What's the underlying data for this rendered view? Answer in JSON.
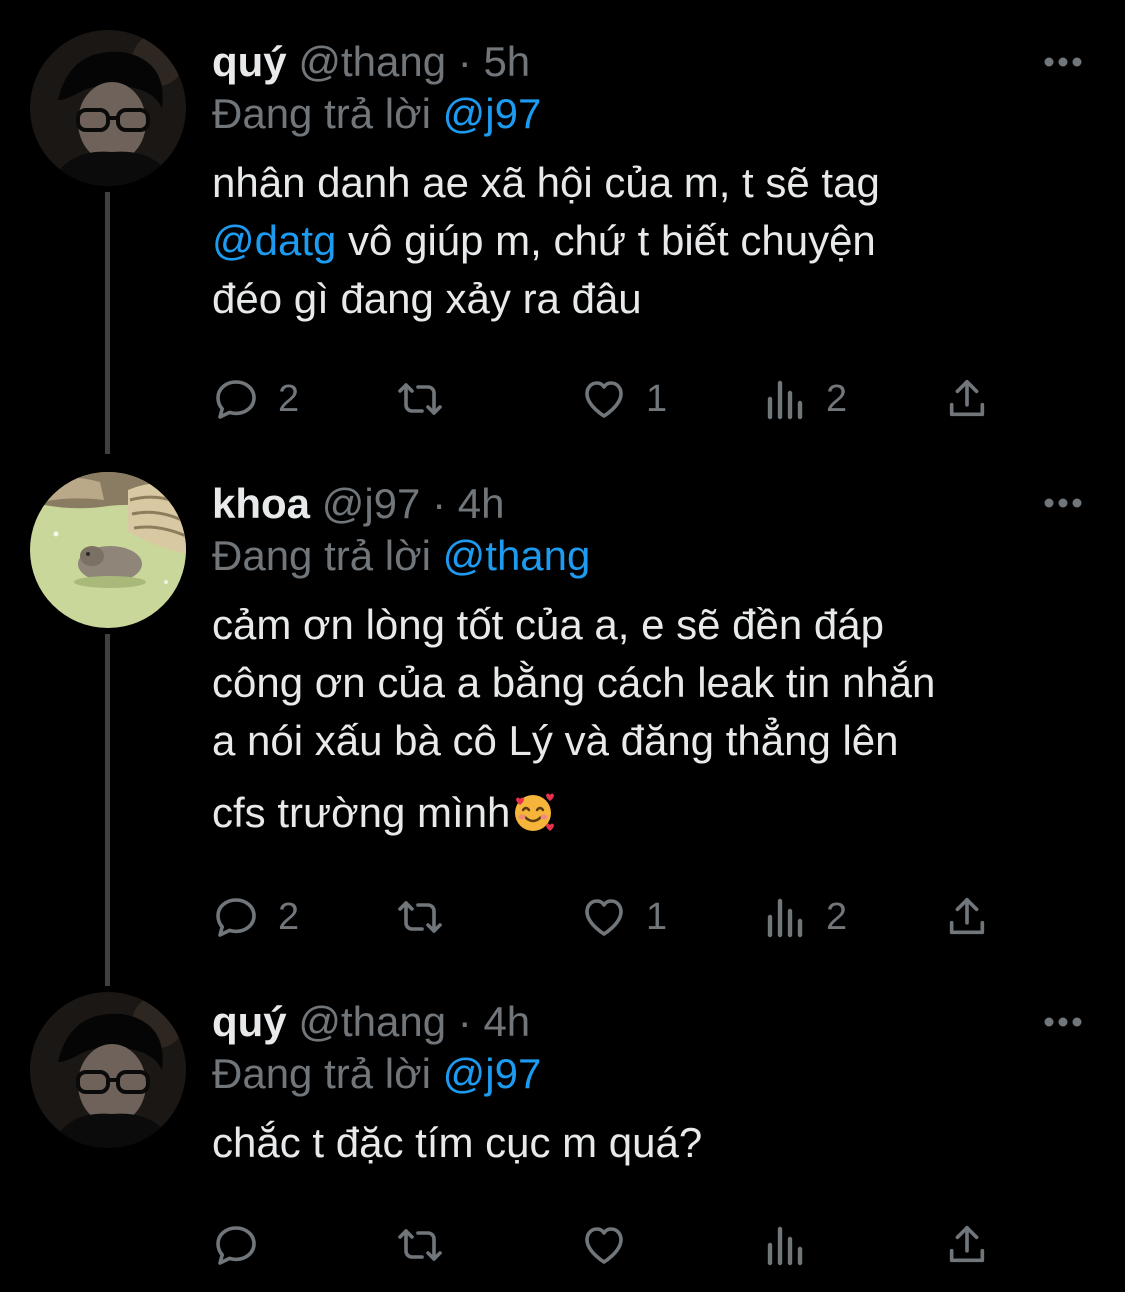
{
  "reply_prefix": "Đang trả lời",
  "tweets": [
    {
      "name": "quý",
      "handle": "@thang",
      "separator": "·",
      "time": "5h",
      "reply_to": "@j97",
      "text": {
        "l1": "nhân danh ae xã hội của m, t sẽ tag",
        "l2_mention": "@datg",
        "l2_rest": " vô giúp m, chứ t biết chuyện",
        "l3": "đéo gì đang xảy ra đâu"
      },
      "replies": "2",
      "retweets": "",
      "likes": "1",
      "views": "2"
    },
    {
      "name": "khoa",
      "handle": "@j97",
      "separator": "·",
      "time": "4h",
      "reply_to": "@thang",
      "text": {
        "l1": "cảm ơn lòng tốt của a, e sẽ đền đáp",
        "l2": "công ơn của a bằng cách leak tin nhắn",
        "l3": "a nói xấu bà cô Lý và đăng thẳng lên",
        "l4": "cfs trường mình"
      },
      "emoji": "smiling-face-with-hearts",
      "replies": "2",
      "retweets": "",
      "likes": "1",
      "views": "2"
    },
    {
      "name": "quý",
      "handle": "@thang",
      "separator": "·",
      "time": "4h",
      "reply_to": "@j97",
      "text": {
        "l1": "chắc t đặc tím cục m quá?"
      },
      "replies": "",
      "retweets": "",
      "likes": "",
      "views": ""
    }
  ],
  "colors": {
    "background": "#000000",
    "text": "#e7e9ea",
    "muted": "#71767b",
    "accent": "#1d9bf0",
    "thread_line": "#3e4144"
  }
}
